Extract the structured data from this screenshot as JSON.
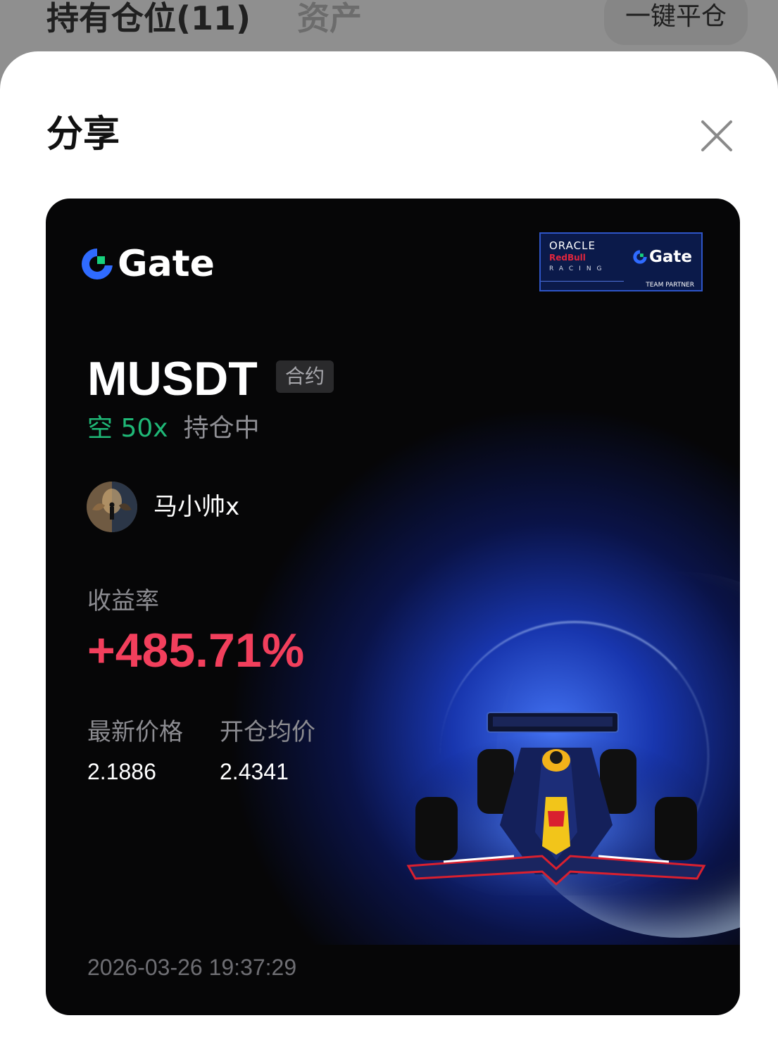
{
  "background": {
    "tabs": [
      {
        "label": "持有仓位(11)",
        "active": true
      },
      {
        "label": "资产",
        "active": false
      }
    ],
    "close_all_label": "一键平仓"
  },
  "sheet": {
    "title": "分享",
    "close_icon": "close-icon"
  },
  "card": {
    "brand": "Gate",
    "partner_badge": {
      "line1": "ORACLE",
      "line2": "RedBull",
      "line3": "RACING",
      "brand": "Gate",
      "label": "TEAM PARTNER"
    },
    "symbol": "MUSDT",
    "contract_type": "合约",
    "direction": "空 50x",
    "position_status": "持仓中",
    "username": "马小帅x",
    "roi_label": "收益率",
    "roi_value": "+485.71%",
    "latest_price_label": "最新价格",
    "latest_price": "2.1886",
    "entry_price_label": "开仓均价",
    "entry_price": "2.4341",
    "timestamp": "2026-03-26 19:37:29"
  },
  "colors": {
    "short": "#1fb877",
    "roi_positive": "#f23f5c",
    "brand_blue": "#2f6bff",
    "brand_green": "#17d17e"
  }
}
